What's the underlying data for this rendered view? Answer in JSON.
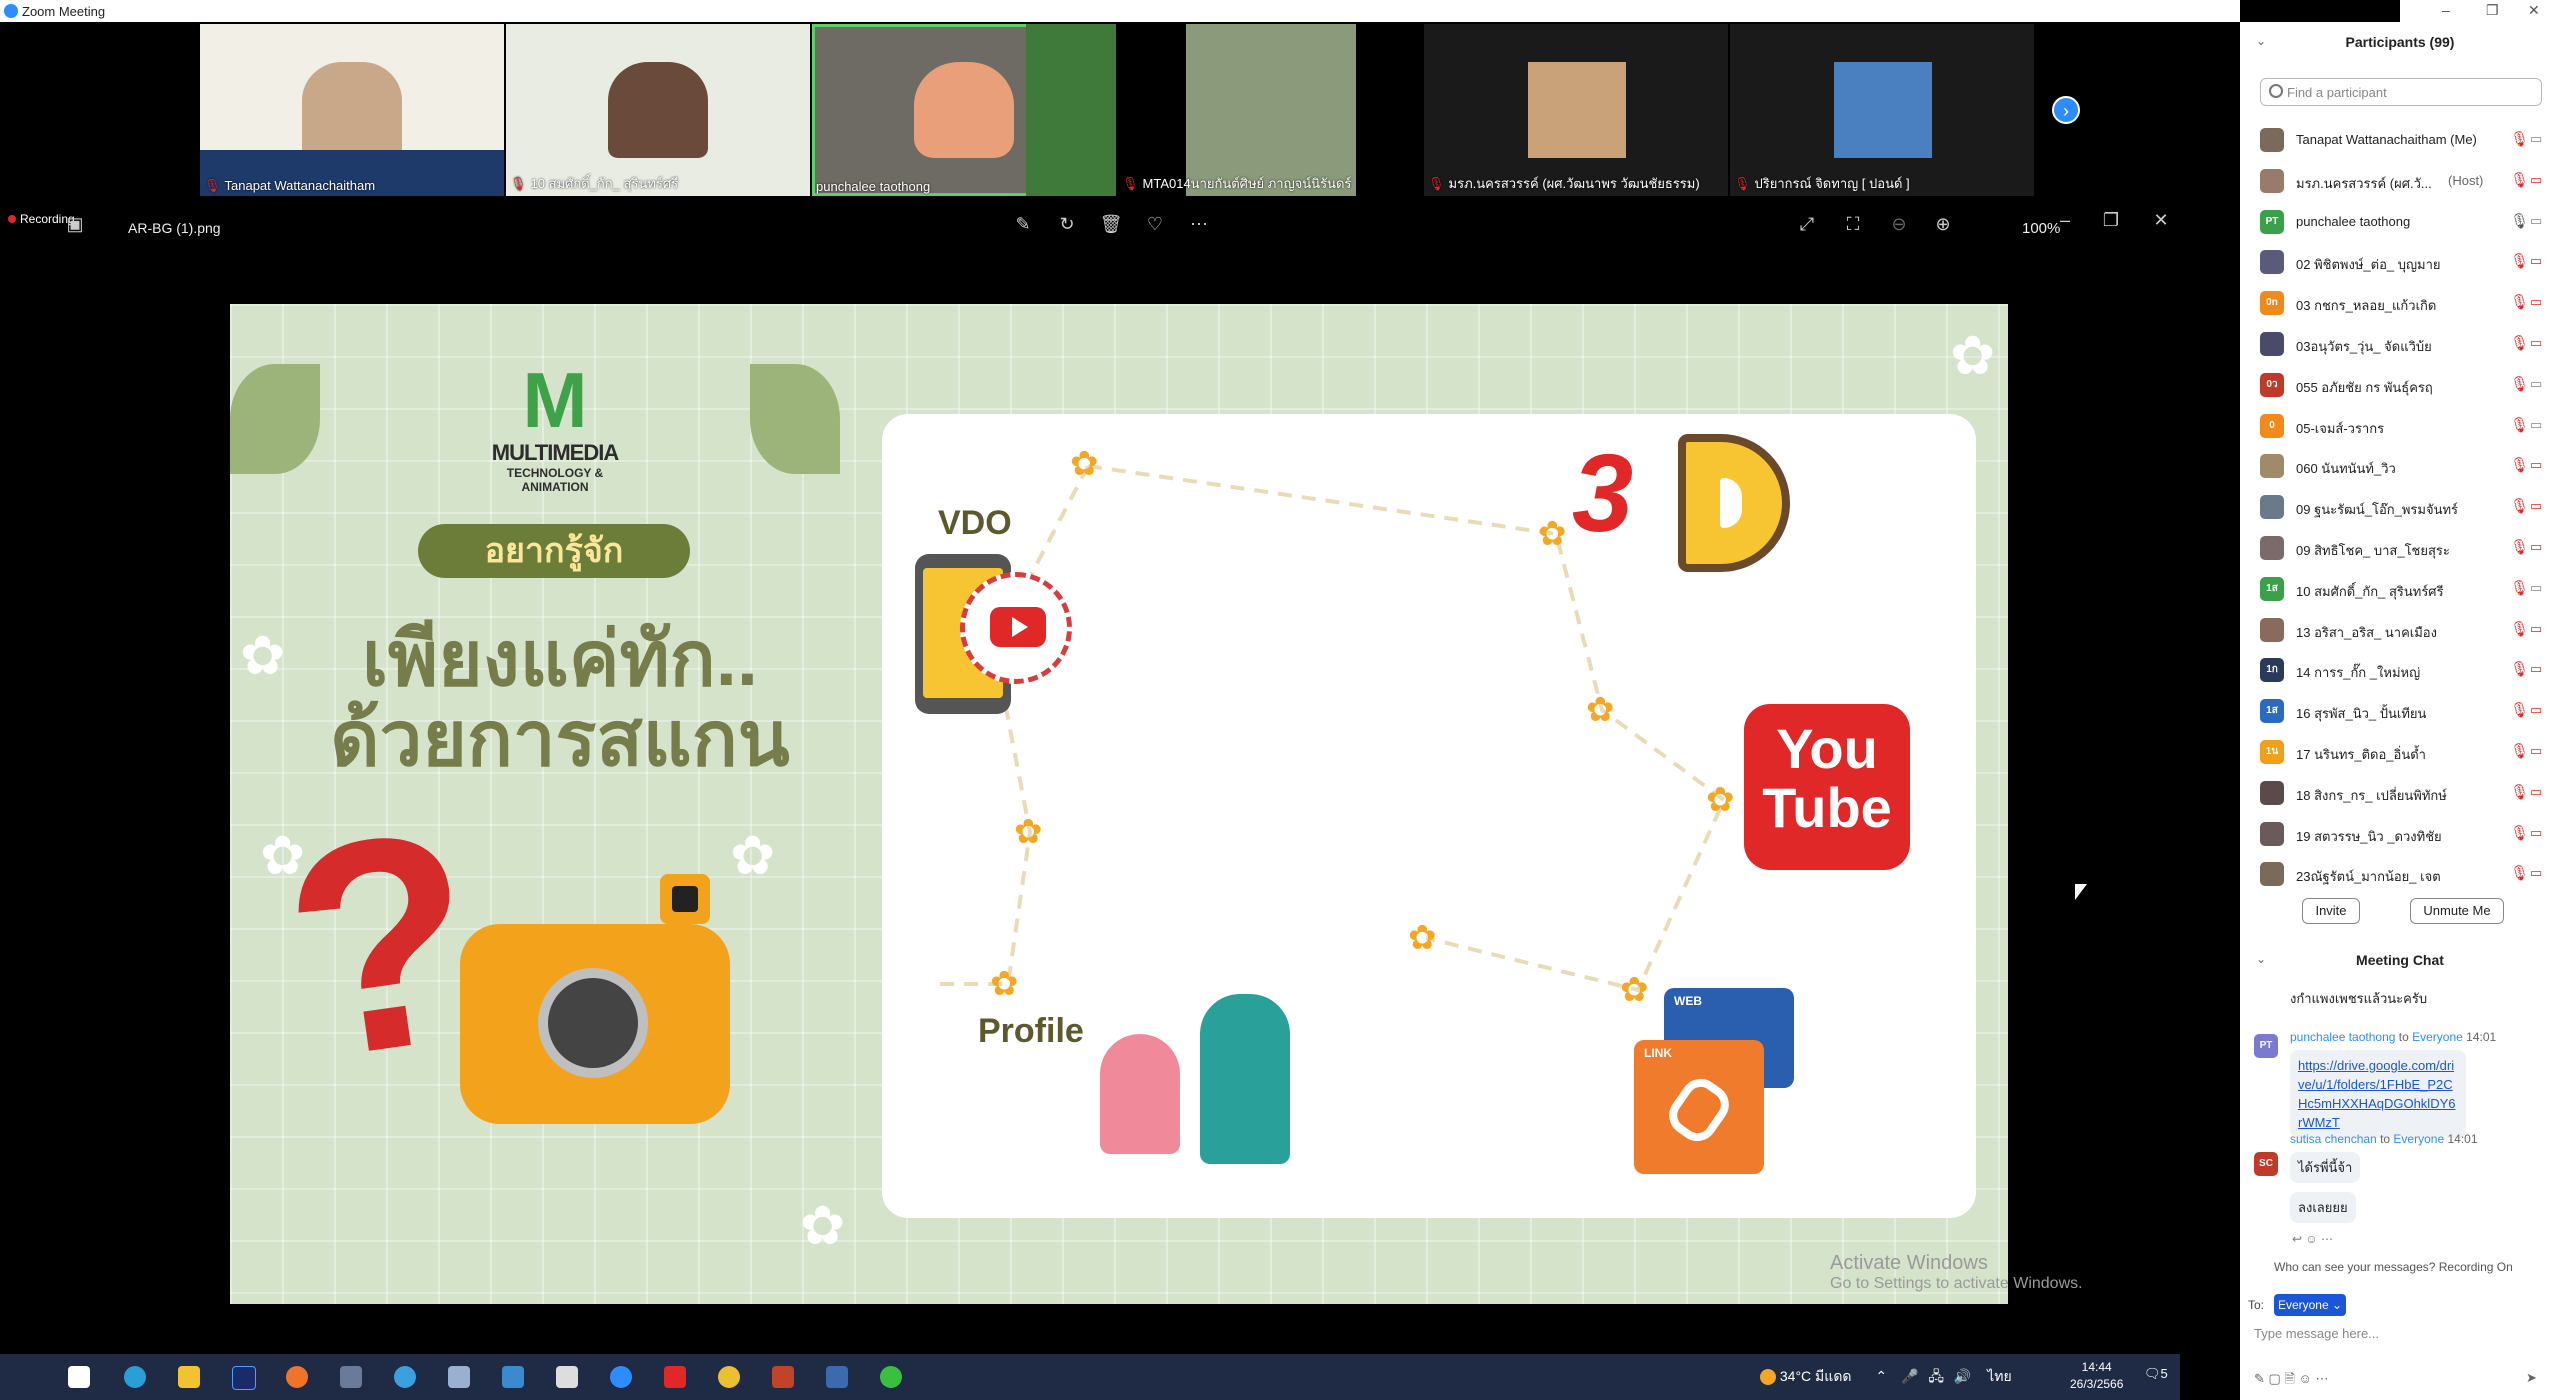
{
  "window": {
    "title": "Zoom Meeting"
  },
  "gallery": {
    "tiles": [
      {
        "name": "Tanapat Wattanachaitham",
        "muted": true
      },
      {
        "name": "10 สมศักดิ์_กัก_ สุรินทร์ศรี",
        "muted": true
      },
      {
        "name": "punchalee taothong",
        "muted": false
      },
      {
        "name": "MTA014นายกันต์ศิษย์ ภาญจน์นิรันดร์",
        "muted": true
      },
      {
        "name": "มรภ.นครสวรรค์ (ผศ.วัฒนาพร วัฒนชัยธรรม)",
        "muted": true
      },
      {
        "name": "ปริยากรณ์ จิดทาญ [ ปอนด์ ]",
        "muted": true
      }
    ]
  },
  "viewer": {
    "recording_label": "Recording",
    "file_name": "AR-BG (1).png",
    "zoom": "100%"
  },
  "slide": {
    "logo_line1": "MULTIMEDIA",
    "logo_line2": "TECHNOLOGY & ANIMATION",
    "pill": "อยากรู้จัก",
    "headline1": "เพียงแค่ทัก..",
    "headline2": "ด้วยการสแกน",
    "vdo_label": "VDO",
    "profile_label": "Profile",
    "three_d": "3",
    "yt_line1": "You",
    "yt_line2": "Tube",
    "web_label": "WEB",
    "link_label": "LINK"
  },
  "activate": {
    "line1": "Activate Windows",
    "line2": "Go to Settings to activate Windows."
  },
  "taskbar": {
    "weather": "34°C มีแดด",
    "lang": "ไทย",
    "time": "14:44",
    "date": "26/3/2566",
    "notif": "5"
  },
  "participants": {
    "header": "Participants (99)",
    "search_placeholder": "Find a participant",
    "list": [
      {
        "initials": "",
        "name": "Tanapat Wattanachaitham (Me)",
        "role": "",
        "color": "#7a6a5a",
        "mic_muted": true,
        "cam_off": false
      },
      {
        "initials": "",
        "name": "มรภ.นครสวรรค์ (ผศ.วั...",
        "role": "(Host)",
        "color": "#9a7a6a",
        "mic_muted": true,
        "cam_off": true
      },
      {
        "initials": "PT",
        "name": "punchalee taothong",
        "role": "",
        "color": "#3aa04a",
        "mic_muted": false,
        "cam_off": false
      },
      {
        "initials": "",
        "name": "02 พิชิตพงษ์_ต่อ_ บุญมาย",
        "role": "",
        "color": "#5a5a7a",
        "mic_muted": true,
        "cam_off": true
      },
      {
        "initials": "0n",
        "name": "03 กชกร_หลอย_แก้วเกิด",
        "role": "",
        "color": "#f08a1a",
        "mic_muted": true,
        "cam_off": true
      },
      {
        "initials": "",
        "name": "03อนุวัตร_วุ่น_ จัดแวิบ้ย",
        "role": "",
        "color": "#4a4a6a",
        "mic_muted": true,
        "cam_off": true
      },
      {
        "initials": "0ว",
        "name": "055 อภัยชัย กร พันธุ์ครฤ",
        "role": "",
        "color": "#c03a2a",
        "mic_muted": true,
        "cam_off": false
      },
      {
        "initials": "0",
        "name": "05-เจมส์-วรากร",
        "role": "",
        "color": "#f08a1a",
        "mic_muted": true,
        "cam_off": false
      },
      {
        "initials": "",
        "name": "060 นันทนันท์_วิว",
        "role": "",
        "color": "#a08a6a",
        "mic_muted": true,
        "cam_off": true
      },
      {
        "initials": "",
        "name": "09 ฐนะรัฒน์_โอ๊ก_พรมจันทร์",
        "role": "",
        "color": "#6a7a8a",
        "mic_muted": true,
        "cam_off": true
      },
      {
        "initials": "",
        "name": "09 สิทธิโชค_ บาส_โชยสุระ",
        "role": "",
        "color": "#7a6a6a",
        "mic_muted": true,
        "cam_off": true
      },
      {
        "initials": "1ส",
        "name": "10 สมศักดิ์_กัก_ สุรินทร์ศรี",
        "role": "",
        "color": "#3aa04a",
        "mic_muted": true,
        "cam_off": false
      },
      {
        "initials": "",
        "name": "13 อริสา_อริส_ นาคเมือง",
        "role": "",
        "color": "#8a6a5a",
        "mic_muted": true,
        "cam_off": true
      },
      {
        "initials": "1ก",
        "name": "14 การร_กั๊ก _ใหม่หญ่",
        "role": "",
        "color": "#2a3a5a",
        "mic_muted": true,
        "cam_off": true
      },
      {
        "initials": "1ส",
        "name": "16 สุรพัส_นิว_ ปั้นเทียน",
        "role": "",
        "color": "#2a6ac0",
        "mic_muted": true,
        "cam_off": true
      },
      {
        "initials": "1น",
        "name": "17 นรินทร_ติดอ_อิ่นด้ำ",
        "role": "",
        "color": "#f0a01a",
        "mic_muted": true,
        "cam_off": true
      },
      {
        "initials": "",
        "name": "18 สิงกร_กร_ เปลี่ยนพิทักษ์",
        "role": "",
        "color": "#5a4a4a",
        "mic_muted": true,
        "cam_off": true
      },
      {
        "initials": "",
        "name": "19 สตวรรษ_นิว _ดวงทิชัย",
        "role": "",
        "color": "#6a5a5a",
        "mic_muted": true,
        "cam_off": true
      },
      {
        "initials": "",
        "name": "23ณัฐรัตน์_มากน้อย_ เจต",
        "role": "",
        "color": "#7a6a5a",
        "mic_muted": true,
        "cam_off": true
      }
    ],
    "invite": "Invite",
    "unmute": "Unmute Me"
  },
  "chat": {
    "header": "Meeting Chat",
    "prev_fragment": "งกําแพงเพชรแล้วนะครับ",
    "messages": [
      {
        "initials": "PT",
        "color": "#7a7ad0",
        "sender": "punchalee taothong",
        "to": " to ",
        "audience": "Everyone",
        "time": "14:01",
        "text": "https://drive.google.com/drive/u/1/folders/1FHbE_P2CHc5mHXXHAqDGOhklDY6rWMzT"
      },
      {
        "initials": "SC",
        "color": "#c03a2a",
        "sender": "sutisa chenchan",
        "to": " to ",
        "audience": "Everyone",
        "time": "14:01",
        "text": "ได้รพี่นี้จ้า",
        "text2": "ลงเลยยย"
      }
    ],
    "who_can_see": "Who can see your messages? Recording On",
    "to_label": "To:",
    "to_value": "Everyone",
    "input_placeholder": "Type message here..."
  }
}
